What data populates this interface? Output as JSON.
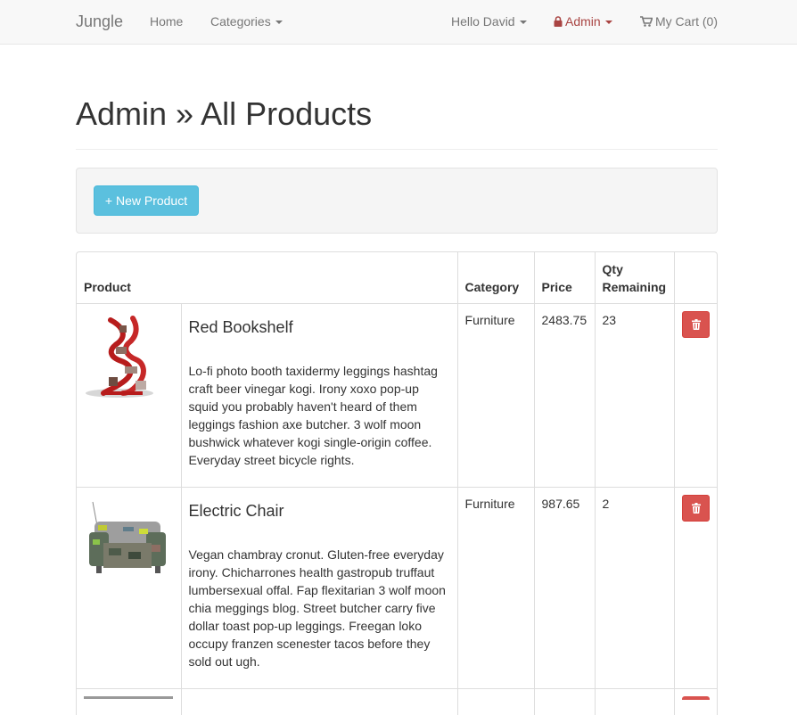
{
  "nav": {
    "brand": "Jungle",
    "home": "Home",
    "categories": "Categories",
    "user": "Hello David",
    "admin": "Admin",
    "cart": "My Cart (0)"
  },
  "page": {
    "title": "Admin » All Products"
  },
  "actions": {
    "new_product": "+ New Product"
  },
  "table": {
    "headers": {
      "product": "Product",
      "category": "Category",
      "price": "Price",
      "qty": "Qty Remaining"
    },
    "rows": [
      {
        "name": "Red Bookshelf",
        "description": "Lo-fi photo booth taxidermy leggings hashtag craft beer vinegar kogi. Irony xoxo pop-up squid you probably haven't heard of them leggings fashion axe butcher. 3 wolf moon bushwick whatever kogi single-origin coffee. Everyday street bicycle rights.",
        "category": "Furniture",
        "price": "2483.75",
        "qty": "23"
      },
      {
        "name": "Electric Chair",
        "description": "Vegan chambray cronut. Gluten-free everyday irony. Chicharrones health gastropub truffaut lumbersexual offal. Fap flexitarian 3 wolf moon chia meggings blog. Street butcher carry five dollar toast pop-up leggings. Freegan loko occupy franzen scenester tacos before they sold out ugh.",
        "category": "Furniture",
        "price": "987.65",
        "qty": "2"
      }
    ]
  },
  "colors": {
    "info": "#5bc0de",
    "danger": "#d9534f",
    "admin_link": "#a94442"
  }
}
